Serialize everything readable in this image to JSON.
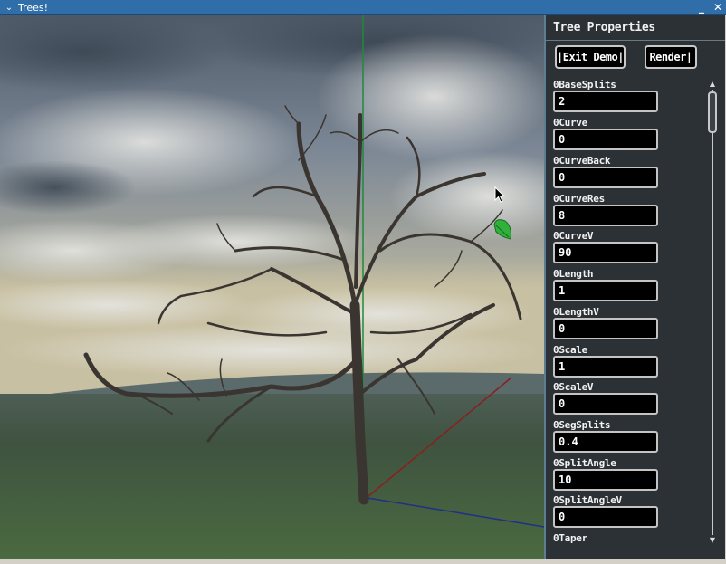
{
  "window": {
    "title": "Trees!",
    "menu_glyph": "⌄",
    "minimize_glyph": "_",
    "close_glyph": "✕"
  },
  "panel": {
    "title": "Tree Properties",
    "exit_label": "|Exit Demo|",
    "render_label": "Render|",
    "properties": [
      {
        "label": "0BaseSplits",
        "value": "2"
      },
      {
        "label": "0Curve",
        "value": "0"
      },
      {
        "label": "0CurveBack",
        "value": "0"
      },
      {
        "label": "0CurveRes",
        "value": "8"
      },
      {
        "label": "0CurveV",
        "value": "90"
      },
      {
        "label": "0Length",
        "value": "1"
      },
      {
        "label": "0LengthV",
        "value": "0"
      },
      {
        "label": "0Scale",
        "value": "1"
      },
      {
        "label": "0ScaleV",
        "value": "0"
      },
      {
        "label": "0SegSplits",
        "value": "0.4"
      },
      {
        "label": "0SplitAngle",
        "value": "10"
      },
      {
        "label": "0SplitAngleV",
        "value": "0"
      },
      {
        "label": "0Taper",
        "value": ""
      }
    ],
    "scroll_position": 0.02
  },
  "icons": {
    "cursor": "mouse-pointer-icon",
    "leaf": "leaf-icon"
  },
  "colors": {
    "title_bar": "#2f6ea9",
    "panel_bg": "#2c3135",
    "axis_y": "#1e8a3a",
    "axis_x": "#8a1f1f",
    "axis_z": "#1f2f8a",
    "leaf": "#2fb13a"
  }
}
